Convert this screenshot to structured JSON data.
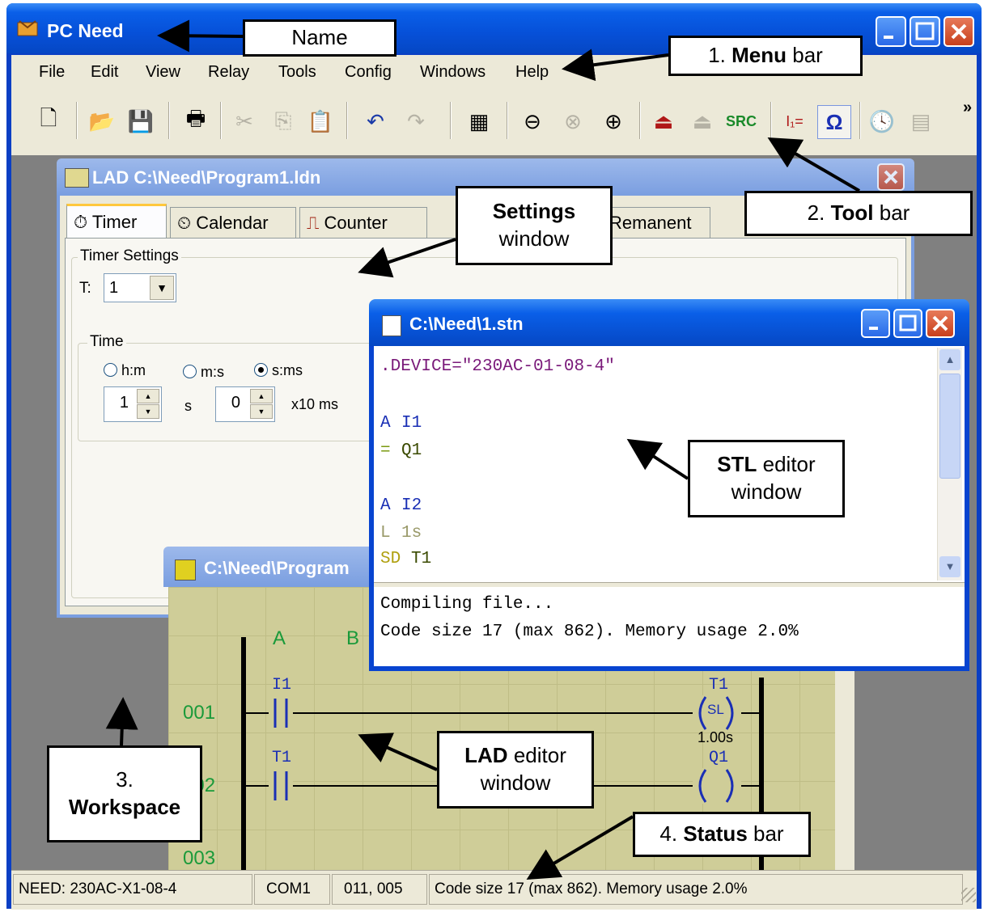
{
  "app": {
    "title": "PC Need"
  },
  "menu": [
    "File",
    "Edit",
    "View",
    "Relay",
    "Tools",
    "Config",
    "Windows",
    "Help"
  ],
  "settings_window": {
    "title": "LAD C:\\Need\\Program1.ldn",
    "tabs": [
      "Timer",
      "Calendar",
      "Counter",
      "Remanent"
    ],
    "group_timer": "Timer Settings",
    "t_label": "T:",
    "t_value": "1",
    "group_time": "Time",
    "radios": [
      "h:m",
      "m:s",
      "s:ms"
    ],
    "selected_radio": "s:ms",
    "value1": "1",
    "unit1": "s",
    "value2": "0",
    "unit2": "x10 ms"
  },
  "stl_window": {
    "title": "C:\\Need\\1.stn",
    "lines": [
      {
        "kw": ".DEVICE=\"230AC-01-08-4\"",
        "arg": ""
      },
      {
        "kw": "",
        "arg": ""
      },
      {
        "kw": "A",
        "arg": "I1"
      },
      {
        "kw": "=",
        "arg": "Q1"
      },
      {
        "kw": "",
        "arg": ""
      },
      {
        "kw": "A",
        "arg": "I2"
      },
      {
        "kw": "L",
        "arg": "1s"
      },
      {
        "kw": "SD",
        "arg": "T1"
      }
    ],
    "output": [
      "Compiling file...",
      "Code size 17 (max 862). Memory usage 2.0%"
    ]
  },
  "lad_window": {
    "title": "C:\\Need\\Program",
    "columns": [
      "A",
      "B"
    ],
    "rows": [
      "001",
      "002",
      "003"
    ],
    "contacts": [
      "I1",
      "T1"
    ],
    "coils": [
      {
        "label": "T1",
        "symbol": "SL",
        "note": "1.00s"
      },
      {
        "label": "Q1",
        "symbol": "",
        "note": ""
      }
    ]
  },
  "status": {
    "device": "NEED: 230AC-X1-08-4",
    "port": "COM1",
    "position": "011, 005",
    "message": "Code size 17 (max 862). Memory usage 2.0%"
  },
  "callouts": {
    "name": "Name",
    "menu_num": "1.",
    "menu_bold": "Menu",
    "menu_rest": "bar",
    "tool_num": "2.",
    "tool_bold": "Tool",
    "tool_rest": "bar",
    "settings_bold": "Settings",
    "settings_rest": "window",
    "stl_bold": "STL",
    "stl_rest": "editor",
    "stl_line2": "window",
    "lad_bold": "LAD",
    "lad_rest": "editor",
    "lad_line2": "window",
    "ws_num": "3.",
    "ws_bold": "Workspace",
    "status_num": "4.",
    "status_bold": "Status",
    "status_rest": "bar"
  },
  "colors": {
    "xp_blue": "#0a5fe8",
    "lad_bg": "#cfcd98",
    "stl_kw_blue": "#1a2fb5",
    "stl_kw_green": "#7a9a10"
  }
}
